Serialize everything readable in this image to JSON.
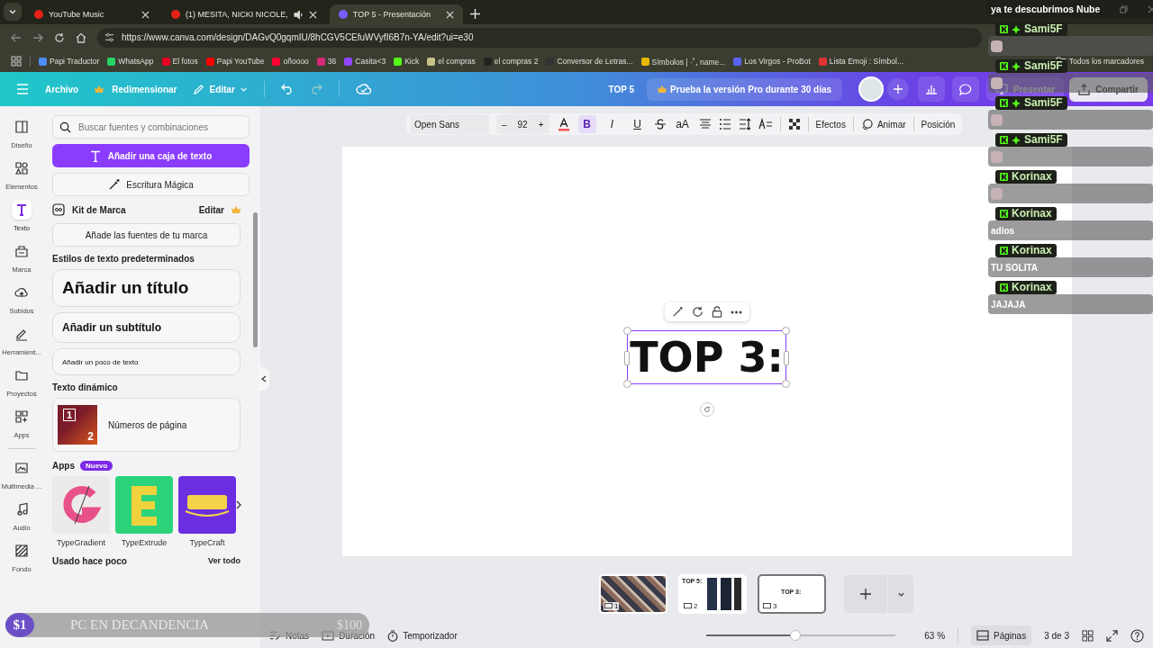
{
  "browser": {
    "tabs": [
      {
        "title": "YouTube Music",
        "selected": false,
        "audio": false
      },
      {
        "title": "(1) MESITA, NICKI NICOLE,",
        "selected": false,
        "audio": true
      },
      {
        "title": "TOP 5 - Presentación",
        "selected": true,
        "audio": false
      }
    ],
    "url": "https://www.canva.com/design/DAGvQ0gqmIU/8hCGV5CEfuWVyfI6B7n-YA/edit?ui=e30",
    "bookmarks": [
      "Papi Traductor",
      "WhatsApp",
      "El fotos",
      "Papi YouTube",
      "oñoooo",
      "36",
      "Casita<3",
      "Kick",
      "el compras",
      "el compras 2",
      "Conversor de Letras...",
      "Símbolos | ·˚₊ name...",
      "Los Virgos - ProBot",
      "Lista Emoji : Símbol..."
    ],
    "all_bookmarks": "Todos los marcadores"
  },
  "header": {
    "file": "Archivo",
    "resize": "Redimensionar",
    "edit": "Editar",
    "title": "TOP 5",
    "pro": "Prueba la versión Pro durante 30 días",
    "present": "Presentar",
    "share": "Compartir"
  },
  "toolbar": {
    "font": "Open Sans",
    "size": "92",
    "minus": "–",
    "plus": "+",
    "bold": true,
    "bold_label": "B",
    "italic": false,
    "italic_label": "I",
    "underline": false,
    "underline_label": "U",
    "case": "aA",
    "effects": "Efectos",
    "animate": "Animar",
    "position": "Posición"
  },
  "rail": [
    {
      "label": "Diseño",
      "selected": false
    },
    {
      "label": "Elementos",
      "selected": false
    },
    {
      "label": "Texto",
      "selected": true
    },
    {
      "label": "Marca",
      "selected": false
    },
    {
      "label": "Subidos",
      "selected": false
    },
    {
      "label": "Herramient...",
      "selected": false
    },
    {
      "label": "Proyectos",
      "selected": false
    },
    {
      "label": "Apps",
      "selected": false
    },
    {
      "label": "Multimedia ...",
      "selected": false
    },
    {
      "label": "Audio",
      "selected": false
    },
    {
      "label": "Fondo",
      "selected": false
    }
  ],
  "panel": {
    "search_placeholder": "Buscar fuentes y combinaciones",
    "add_text": "Añadir una caja de texto",
    "magic_write": "Escritura Mágica",
    "brand_kit": "Kit de Marca",
    "brand_edit": "Editar",
    "brand_fonts": "Añade las fuentes de tu marca",
    "styles_heading": "Estilos de texto predeterminados",
    "styles": [
      {
        "kind": "title",
        "label": "Añadir un título"
      },
      {
        "kind": "subtitle",
        "label": "Añadir un subtítulo"
      },
      {
        "kind": "body",
        "label": "Añadir un poco de texto"
      }
    ],
    "dynamic_heading": "Texto dinámico",
    "page_numbers": "Números de página",
    "page_numbers_thumb": [
      "1",
      "2"
    ],
    "apps_heading": "Apps",
    "apps_badge": "Nuevo",
    "apps": [
      {
        "name": "TypeGradient",
        "kind": "gradient"
      },
      {
        "name": "TypeExtrude",
        "kind": "extrude"
      },
      {
        "name": "TypeCraft",
        "kind": "craft"
      }
    ],
    "recent_heading": "Usado hace poco",
    "see_all": "Ver todo"
  },
  "canvas": {
    "text": "TOP 3:"
  },
  "pages": [
    {
      "number": "1",
      "selected": false
    },
    {
      "number": "2",
      "thumb_text": "TOP 5:",
      "selected": false
    },
    {
      "number": "3",
      "thumb_text": "TOP 3:",
      "selected": true
    }
  ],
  "status_bar": {
    "notes": "Notas",
    "duration": "Duración",
    "timer": "Temporizador",
    "zoom": {
      "level": 0.47
    },
    "zoom_label": "63 %",
    "pages": "Páginas",
    "page_count": "3 de 3"
  },
  "chat": {
    "title": "ya te descubrimos Nube",
    "messages": [
      {
        "user": "Sami5F",
        "extra_badge": true,
        "kind": "emote"
      },
      {
        "user": "Sami5F",
        "extra_badge": true,
        "kind": "emote"
      },
      {
        "user": "Sami5F",
        "extra_badge": true,
        "kind": "emote"
      },
      {
        "user": "Sami5F",
        "extra_badge": true,
        "kind": "emote"
      },
      {
        "user": "Korinax",
        "extra_badge": false,
        "kind": "emote"
      },
      {
        "user": "Korinax",
        "extra_badge": false,
        "kind": "text",
        "text": "adios"
      },
      {
        "user": "Korinax",
        "extra_badge": false,
        "kind": "text",
        "text": "TU SOLITA"
      },
      {
        "user": "Korinax",
        "extra_badge": false,
        "kind": "text",
        "text": "JAJAJA"
      }
    ]
  },
  "donation_goal": {
    "current": "$1",
    "title": "PC EN DECANDENCIA",
    "target": "$100"
  }
}
